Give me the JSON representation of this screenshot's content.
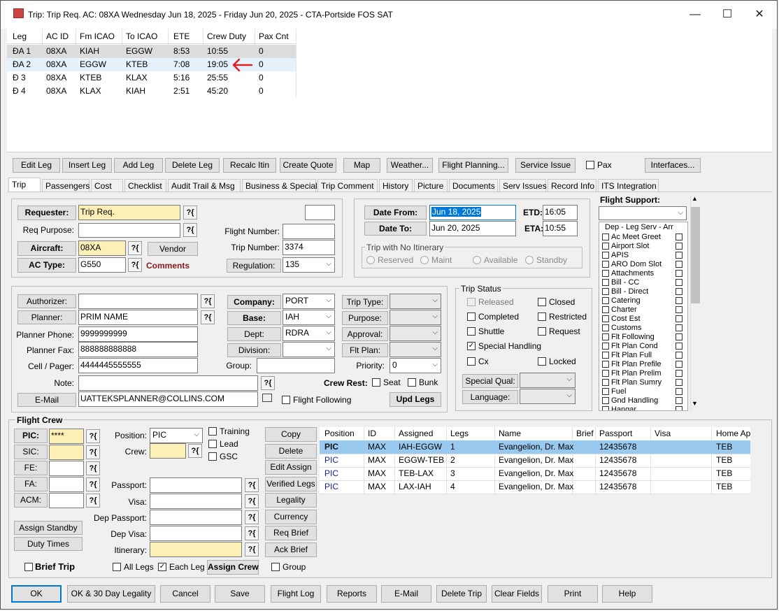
{
  "window": {
    "title": "Trip: Trip Req.  AC: 08XA  Wednesday Jun 18, 2025 - Friday Jun 20, 2025 - CTA-Portside FOS SAT",
    "minimize": "—",
    "maximize": "☐",
    "close": "✕"
  },
  "legs_grid": {
    "columns": [
      "Leg",
      "AC ID",
      "Fm ICAO",
      "To ICAO",
      "ETE",
      "Crew Duty",
      "Pax Cnt"
    ],
    "rows": [
      [
        "ĐA 1",
        "08XA",
        "KIAH",
        "EGGW",
        "8:53",
        "10:55",
        "0"
      ],
      [
        "ĐA 2",
        "08XA",
        "EGGW",
        "KTEB",
        "7:08",
        "19:05",
        "0"
      ],
      [
        "Đ 3",
        "08XA",
        "KTEB",
        "KLAX",
        "5:16",
        "25:55",
        "0"
      ],
      [
        "Đ 4",
        "08XA",
        "KLAX",
        "KIAH",
        "2:51",
        "45:20",
        "0"
      ]
    ],
    "annotation_arrow_color": "#e02020"
  },
  "toolbar": {
    "buttons": [
      "Edit Leg",
      "Insert Leg",
      "Add Leg",
      "Delete Leg",
      "Recalc Itin",
      "Create Quote",
      "Map",
      "Weather...",
      "Flight Planning...",
      "Service Issue"
    ],
    "pax_label": "Pax",
    "interfaces": "Interfaces..."
  },
  "tabs": [
    "Trip",
    "Passengers",
    "Cost",
    "Checklist",
    "Audit Trail & Msg",
    "Business & Special",
    "Trip Comment",
    "History",
    "Picture",
    "Documents",
    "Serv Issues",
    "Record Info",
    "ITS Integration"
  ],
  "trip": {
    "requester_label": "Requester:",
    "requester_value": "Trip Req.",
    "req_purpose_label": "Req Purpose:",
    "aircraft_label": "Aircraft:",
    "aircraft_value": "08XA",
    "vendor": "Vendor",
    "ac_type_label": "AC Type:",
    "ac_type_value": "G550",
    "comments": "Comments",
    "flight_number_label": "Flight Number:",
    "trip_number_label": "Trip Number:",
    "trip_number_value": "3374",
    "regulation_label": "Regulation:",
    "regulation_value": "135",
    "q_icon": "?{"
  },
  "dates": {
    "date_from_label": "Date From:",
    "date_from_value": "Jun 18, 2025",
    "date_to_label": "Date To:",
    "date_to_value": "Jun 20, 2025",
    "etd_label": "ETD:",
    "etd_value": "16:05",
    "eta_label": "ETA:",
    "eta_value": "10:55",
    "no_itin_label": "Trip with No Itinerary",
    "radios": [
      "Reserved",
      "Maint",
      "Available",
      "Standby"
    ]
  },
  "flight_support": {
    "label": "Flight Support:",
    "list_header": "Dep - Leg Serv - Arr",
    "items": [
      "Ac Meet Greet",
      "Airport Slot",
      "APIS",
      "ARO Dom Slot",
      "Attachments",
      "Bill - CC",
      "Bill - Direct",
      "Catering",
      "Charter",
      "Cost Est",
      "Customs",
      "Flt Following",
      "Flt Plan Cond",
      "Flt Plan Full",
      "Flt Plan Prefile",
      "Flt Plan Prelim",
      "Flt Plan Sumry",
      "Fuel",
      "Gnd Handling",
      "Hangar"
    ]
  },
  "contact": {
    "authorizer_label": "Authorizer:",
    "planner_label": "Planner:",
    "planner_value": "PRIM NAME",
    "planner_phone_label": "Planner Phone:",
    "planner_phone_value": "9999999999",
    "planner_fax_label": "Planner Fax:",
    "planner_fax_value": "888888888888",
    "cell_label": "Cell / Pager:",
    "cell_value": "4444445555555",
    "note_label": "Note:",
    "email_label": "E-Mail",
    "email_value": "UATTEKSPLANNER@COLLINS.COM",
    "company_label": "Company:",
    "company_value": "PORT",
    "base_label": "Base:",
    "base_value": "IAH",
    "dept_label": "Dept:",
    "dept_value": "RDRA",
    "division_label": "Division:",
    "group_label": "Group:",
    "trip_type_label": "Trip Type:",
    "purpose_label": "Purpose:",
    "approval_label": "Approval:",
    "flt_plan_label": "Flt Plan:",
    "priority_label": "Priority:",
    "priority_value": "0",
    "crew_rest_label": "Crew Rest:",
    "seat_label": "Seat",
    "bunk_label": "Bunk",
    "flight_following_label": "Flight Following",
    "upd_legs": "Upd Legs"
  },
  "trip_status": {
    "label": "Trip Status",
    "released": "Released",
    "closed": "Closed",
    "completed": "Completed",
    "restricted": "Restricted",
    "shuttle": "Shuttle",
    "request": "Request",
    "special_handling": "Special Handling",
    "cx": "Cx",
    "locked": "Locked",
    "special_qual": "Special Qual:",
    "language": "Language:"
  },
  "crew": {
    "section_label": "Flight Crew",
    "pic_label": "PIC:",
    "pic_value": "****",
    "sic_label": "SIC:",
    "fe_label": "FE:",
    "fa_label": "FA:",
    "acm_label": "ACM:",
    "position_label": "Position:",
    "position_value": "PIC",
    "crew_label": "Crew:",
    "training": "Training",
    "lead": "Lead",
    "gsc": "GSC",
    "passport_label": "Passport:",
    "visa_label": "Visa:",
    "dep_passport_label": "Dep Passport:",
    "dep_visa_label": "Dep Visa:",
    "itinerary_label": "Itinerary:",
    "assign_standby": "Assign Standby",
    "duty_times": "Duty Times",
    "brief_trip": "Brief Trip",
    "all_legs": "All Legs",
    "each_leg": "Each Leg",
    "assign_crew": "Assign Crew",
    "group": "Group",
    "side_buttons": [
      "Copy",
      "Delete",
      "Edit Assign",
      "Verified Legs",
      "Legality",
      "Currency",
      "Req Brief",
      "Ack Brief"
    ],
    "grid_columns": [
      "Position",
      "ID",
      "Assigned",
      "Legs",
      "Name",
      "Brief",
      "Passport",
      "Visa",
      "Home Ap"
    ],
    "grid_rows": [
      [
        "PIC",
        "MAX",
        "IAH-EGGW",
        "1",
        "Evangelion, Dr. Max",
        "",
        "12435678",
        "",
        "TEB"
      ],
      [
        "PIC",
        "MAX",
        "EGGW-TEB",
        "2",
        "Evangelion, Dr. Max",
        "",
        "12435678",
        "",
        "TEB"
      ],
      [
        "PIC",
        "MAX",
        "TEB-LAX",
        "3",
        "Evangelion, Dr. Max",
        "",
        "12435678",
        "",
        "TEB"
      ],
      [
        "PIC",
        "MAX",
        "LAX-IAH",
        "4",
        "Evangelion, Dr. Max",
        "",
        "12435678",
        "",
        "TEB"
      ]
    ]
  },
  "bottom_buttons": [
    "OK",
    "OK & 30 Day Legality",
    "Cancel",
    "Save",
    "Flight Log",
    "Reports",
    "E-Mail",
    "Delete Trip",
    "Clear Fields",
    "Print",
    "Help"
  ],
  "colors": {
    "selected_row": "#99c9ef",
    "hover_row": "#e5f1fb",
    "yellow_field": "#fdf0b6",
    "comments_red": "#8b1a1a"
  }
}
